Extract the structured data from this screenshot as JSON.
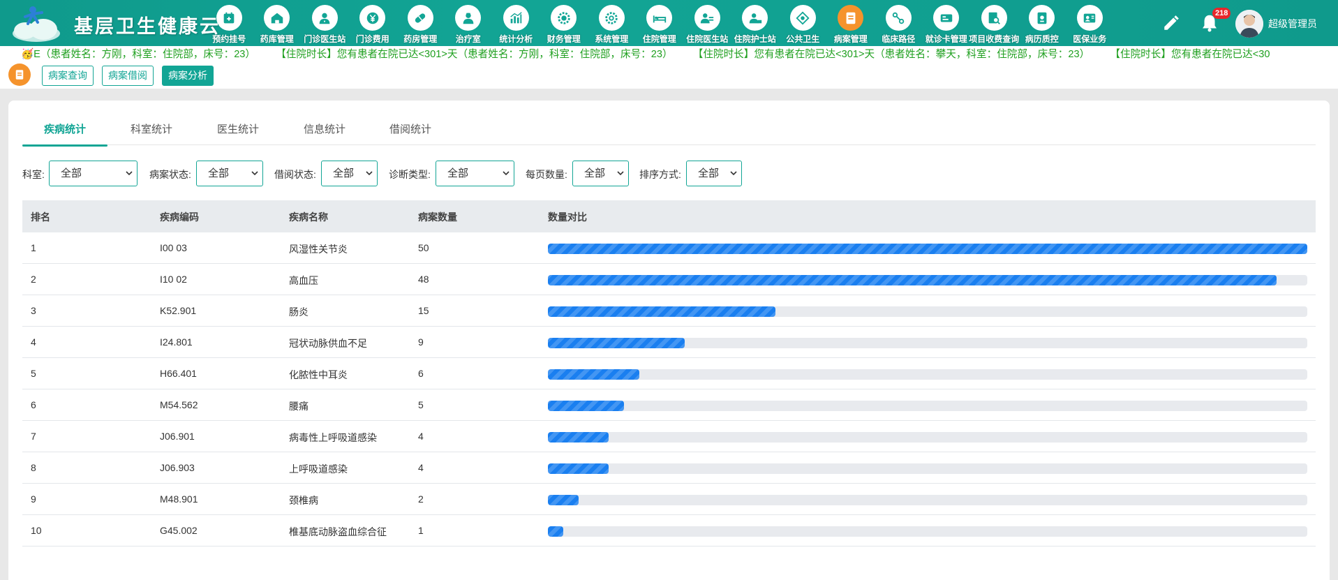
{
  "app": {
    "brand": "基层卫生健康云"
  },
  "nav": [
    {
      "label": "预约挂号",
      "icon": "calendar-icon",
      "active": false
    },
    {
      "label": "药库管理",
      "icon": "warehouse-icon",
      "active": false
    },
    {
      "label": "门诊医生站",
      "icon": "doctor-icon",
      "active": false
    },
    {
      "label": "门诊费用",
      "icon": "yen-icon",
      "active": false
    },
    {
      "label": "药房管理",
      "icon": "pill-icon",
      "active": false
    },
    {
      "label": "治疗室",
      "icon": "nurse-icon",
      "active": false
    },
    {
      "label": "统计分析",
      "icon": "chart-icon",
      "active": false
    },
    {
      "label": "财务管理",
      "icon": "finance-gear-icon",
      "active": false
    },
    {
      "label": "系统管理",
      "icon": "system-gear-icon",
      "active": false
    },
    {
      "label": "住院管理",
      "icon": "bed-icon",
      "active": false
    },
    {
      "label": "住院医生站",
      "icon": "inpatient-doctor-icon",
      "active": false
    },
    {
      "label": "住院护士站",
      "icon": "inpatient-nurse-icon",
      "active": false
    },
    {
      "label": "公共卫生",
      "icon": "public-health-icon",
      "active": false
    },
    {
      "label": "病案管理",
      "icon": "medical-record-icon",
      "active": true
    },
    {
      "label": "临床路径",
      "icon": "path-icon",
      "active": false
    },
    {
      "label": "就诊卡管理",
      "icon": "card-icon",
      "active": false
    },
    {
      "label": "项目收费查询",
      "icon": "fee-search-icon",
      "active": false
    },
    {
      "label": "病历质控",
      "icon": "quality-icon",
      "active": false
    },
    {
      "label": "医保业务",
      "icon": "insurance-icon",
      "active": false
    }
  ],
  "header": {
    "bell_count": "218",
    "user_name": "超级管理员"
  },
  "marquee": "🥳E（患者姓名：方刚，科室：住院部，床号：23）　　　【住院时长】您有患者在院已达<301>天（患者姓名：方刚，科室：住院部，床号：23）　　　【住院时长】您有患者在院已达<301>天（患者姓名：攀天，科室：住院部，床号：23）　　　【住院时长】您有患者在院已达<30",
  "subnav": {
    "items": [
      "病案查询",
      "病案借阅",
      "病案分析"
    ],
    "active": "病案分析"
  },
  "tabs": [
    "疾病统计",
    "科室统计",
    "医生统计",
    "信息统计",
    "借阅统计"
  ],
  "filters": [
    {
      "label": "科室:",
      "value": "全部"
    },
    {
      "label": "病案状态:",
      "value": "全部"
    },
    {
      "label": "借阅状态:",
      "value": "全部"
    },
    {
      "label": "诊断类型:",
      "value": "全部"
    },
    {
      "label": "每页数量:",
      "value": "全部"
    },
    {
      "label": "排序方式:",
      "value": "全部"
    }
  ],
  "table": {
    "columns": [
      "排名",
      "疾病编码",
      "疾病名称",
      "病案数量",
      "数量对比"
    ],
    "rows": [
      {
        "rank": "1",
        "code": "I00 03",
        "name": "风湿性关节炎",
        "count": "50",
        "ratio": 1.0
      },
      {
        "rank": "2",
        "code": "I10 02",
        "name": "高血压",
        "count": "48",
        "ratio": 0.96
      },
      {
        "rank": "3",
        "code": "K52.901",
        "name": "肠炎",
        "count": "15",
        "ratio": 0.3
      },
      {
        "rank": "4",
        "code": "I24.801",
        "name": "冠状动脉供血不足",
        "count": "9",
        "ratio": 0.18
      },
      {
        "rank": "5",
        "code": "H66.401",
        "name": "化脓性中耳炎",
        "count": "6",
        "ratio": 0.12
      },
      {
        "rank": "6",
        "code": "M54.562",
        "name": "腰痛",
        "count": "5",
        "ratio": 0.1
      },
      {
        "rank": "7",
        "code": "J06.901",
        "name": "病毒性上呼吸道感染",
        "count": "4",
        "ratio": 0.08
      },
      {
        "rank": "8",
        "code": "J06.903",
        "name": "上呼吸道感染",
        "count": "4",
        "ratio": 0.08
      },
      {
        "rank": "9",
        "code": "M48.901",
        "name": "颈椎病",
        "count": "2",
        "ratio": 0.04
      },
      {
        "rank": "10",
        "code": "G45.002",
        "name": "椎基底动脉盗血综合征",
        "count": "1",
        "ratio": 0.02
      }
    ]
  },
  "colors": {
    "primary": "#12a595",
    "accent": "#f5932c",
    "bar": "#1a7ff0",
    "marquee": "#20a020"
  }
}
